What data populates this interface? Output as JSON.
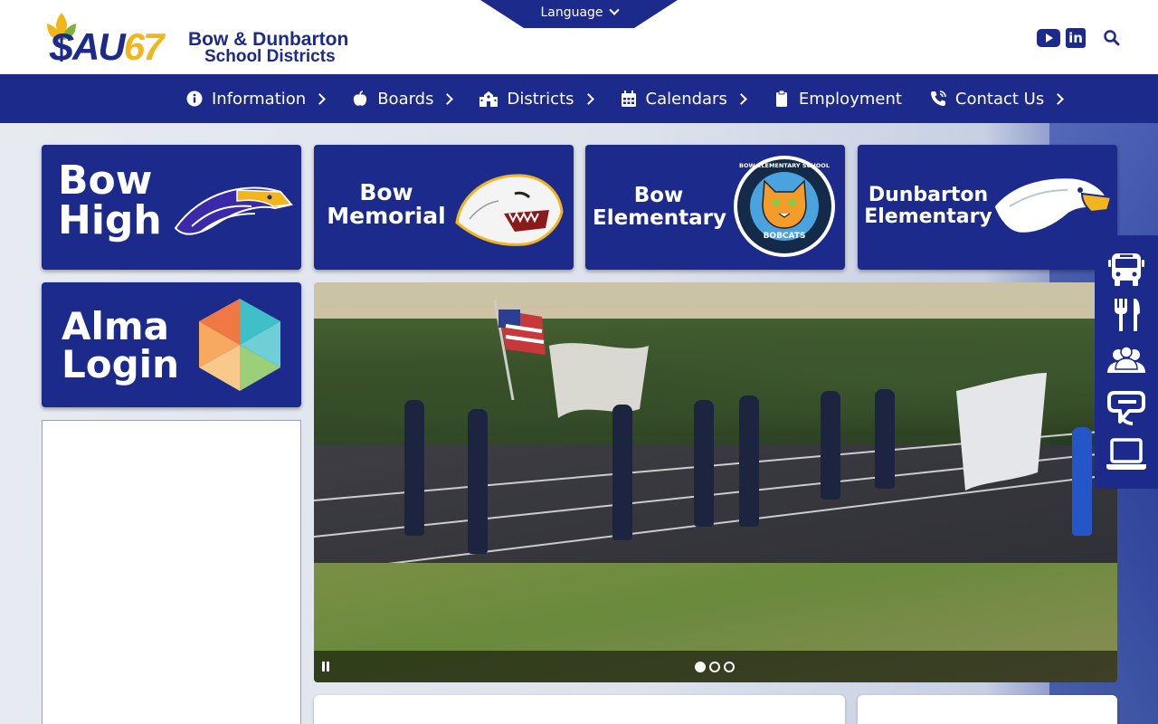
{
  "header": {
    "logo_main": "SAU",
    "logo_number": "67",
    "logo_line1": "Bow & Dunbarton",
    "logo_line2": "School Districts",
    "language_label": "Language"
  },
  "social": {
    "youtube_icon": "youtube-icon",
    "linkedin_icon": "linkedin-icon",
    "linkedin_glyph": "in",
    "search_icon": "search-icon"
  },
  "nav": {
    "items": [
      {
        "label": "Information",
        "icon": "info-icon"
      },
      {
        "label": "Boards",
        "icon": "apple-icon"
      },
      {
        "label": "Districts",
        "icon": "school-icon"
      },
      {
        "label": "Calendars",
        "icon": "calendar-icon"
      },
      {
        "label": "Employment",
        "icon": "clipboard-icon"
      },
      {
        "label": "Contact Us",
        "icon": "phone-icon"
      }
    ]
  },
  "tiles": {
    "bow_high": {
      "l1": "Bow",
      "l2": "High"
    },
    "bow_memorial": {
      "l1": "Bow",
      "l2": "Memorial"
    },
    "bow_elementary": {
      "l1": "Bow",
      "l2": "Elementary",
      "badge_top": "BOW ELEMENTARY SCHOOL",
      "badge_bottom": "BOBCATS"
    },
    "dunbarton_elementary": {
      "l1": "Dunbarton",
      "l2": "Elementary"
    },
    "alma": {
      "l1": "Alma",
      "l2": "Login"
    }
  },
  "slider": {
    "slides": 3,
    "active_slide": 1
  },
  "quick_links": [
    "bus-icon",
    "utensils-icon",
    "users-icon",
    "tutor-icon",
    "laptop-icon"
  ],
  "colors": {
    "brand_navy": "#1c2a8c",
    "brand_gold": "#f2b51c",
    "white": "#ffffff"
  }
}
